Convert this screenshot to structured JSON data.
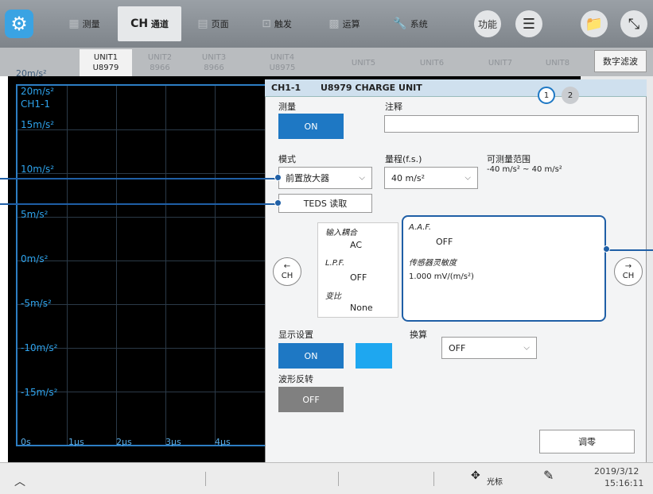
{
  "toolbar": {
    "tabs": [
      {
        "label": "测量"
      },
      {
        "label": "通道",
        "prefix": "CH"
      },
      {
        "label": "页面"
      },
      {
        "label": "触发"
      },
      {
        "label": "运算"
      },
      {
        "label": "系统"
      }
    ],
    "function_label": "功能"
  },
  "units": [
    {
      "name": "UNIT1",
      "model": "U8979"
    },
    {
      "name": "UNIT2",
      "model": "8966"
    },
    {
      "name": "UNIT3",
      "model": "8966"
    },
    {
      "name": "UNIT4",
      "model": "U8975"
    },
    {
      "name": "UNIT5",
      "model": ""
    },
    {
      "name": "UNIT6",
      "model": ""
    },
    {
      "name": "UNIT7",
      "model": ""
    },
    {
      "name": "UNIT8",
      "model": ""
    }
  ],
  "digital_filter_label": "数字滤波",
  "waveform": {
    "y_labels": [
      "20m/s²",
      "CH1-1",
      "15m/s²",
      "10m/s²",
      "5m/s²",
      "0m/s²",
      "-5m/s²",
      "-10m/s²",
      "-15m/s²"
    ],
    "x_labels": [
      "0s",
      "1μs",
      "2μs",
      "3μs",
      "4μs"
    ],
    "ghost_top": "20m/s²"
  },
  "dialog": {
    "channel": "CH1-1",
    "title": "U8979 CHARGE UNIT",
    "pages": [
      "1",
      "2"
    ],
    "measure_label": "测量",
    "measure_value": "ON",
    "comment_label": "注释",
    "comment_value": "",
    "mode_label": "模式",
    "mode_value": "前置放大器",
    "range_label": "量程(f.s.)",
    "range_value": "40 m/s²",
    "measurable_label": "可测量范围",
    "measurable_value": "-40 m/s² ~ 40 m/s²",
    "teds_label": "TEDS 读取",
    "input_coupling_label": "输入耦合",
    "input_coupling_value": "AC",
    "lpf_label": "L.P.F.",
    "lpf_value": "OFF",
    "ratio_label": "变比",
    "ratio_value": "None",
    "aaf_label": "A.A.F.",
    "aaf_value": "OFF",
    "sensitivity_label": "传感器灵敏度",
    "sensitivity_value": "1.000 mV/(m/s²)",
    "prev_ch": "CH",
    "next_ch": "CH",
    "display_label": "显示设置",
    "display_value": "ON",
    "display_color": "#1ea7f0",
    "invert_label": "波形反转",
    "invert_value": "OFF",
    "convert_label": "换算",
    "convert_value": "OFF",
    "zero_adjust_label": "调零"
  },
  "status": {
    "cursor_label": "光标",
    "date": "2019/3/12",
    "time": "15:16:11"
  },
  "colors": {
    "accent": "#1e78c4",
    "callout": "#1f5fa6"
  }
}
